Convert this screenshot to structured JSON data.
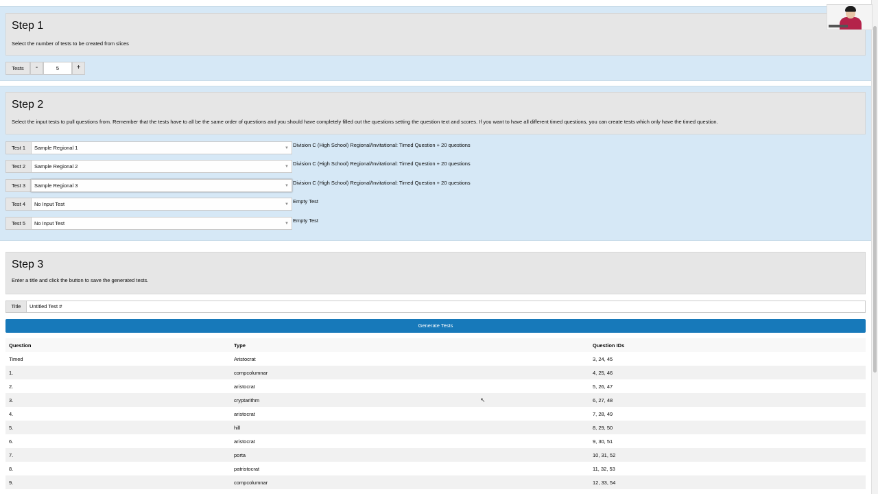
{
  "step1": {
    "heading": "Step 1",
    "description": "Select the number of tests to be created from slices",
    "tests_label": "Tests",
    "minus": "-",
    "count": "5",
    "plus": "+"
  },
  "step2": {
    "heading": "Step 2",
    "description": "Select the input tests to pull questions from. Remember that the tests have to all be the same order of questions and you should have completely filled out the questions setting the question text and scores. If you want to have all different timed questions, you can create tests which only have the timed question.",
    "rows": [
      {
        "label": "Test 1",
        "selected": "Sample Regional 1",
        "info": "Division C (High School) Regional/Invitational: Timed Question + 20 questions"
      },
      {
        "label": "Test 2",
        "selected": "Sample Regional 2",
        "info": "Division C (High School) Regional/Invitational: Timed Question + 20 questions"
      },
      {
        "label": "Test 3",
        "selected": "Sample Regional 3",
        "info": "Division C (High School) Regional/Invitational: Timed Question + 20 questions"
      },
      {
        "label": "Test 4",
        "selected": "No Input Test",
        "info": "Empty Test"
      },
      {
        "label": "Test 5",
        "selected": "No Input Test",
        "info": "Empty Test"
      }
    ]
  },
  "step3": {
    "heading": "Step 3",
    "description": "Enter a title and click the button to save the generated tests.",
    "title_label": "Title",
    "title_value": "Untitled Test #",
    "generate_button": "Generate Tests"
  },
  "table": {
    "headers": [
      "Question",
      "Type",
      "Question IDs"
    ],
    "rows": [
      [
        "Timed",
        "Aristocrat",
        "3, 24, 45"
      ],
      [
        "1.",
        "compcolumnar",
        "4, 25, 46"
      ],
      [
        "2.",
        "aristocrat",
        "5, 26, 47"
      ],
      [
        "3.",
        "cryptarithm",
        "6, 27, 48"
      ],
      [
        "4.",
        "aristocrat",
        "7, 28, 49"
      ],
      [
        "5.",
        "hill",
        "8, 29, 50"
      ],
      [
        "6.",
        "aristocrat",
        "9, 30, 51"
      ],
      [
        "7.",
        "porta",
        "10, 31, 52"
      ],
      [
        "8.",
        "patristocrat",
        "11, 32, 53"
      ],
      [
        "9.",
        "compcolumnar",
        "12, 33, 54"
      ]
    ]
  },
  "icons": {
    "dropdown": "chevron-down-icon",
    "cursor": "mouse-pointer-icon"
  },
  "colors": {
    "panel_blue": "#d6e8f6",
    "callout_gray": "#e6e6e6",
    "button_blue": "#1779ba"
  }
}
